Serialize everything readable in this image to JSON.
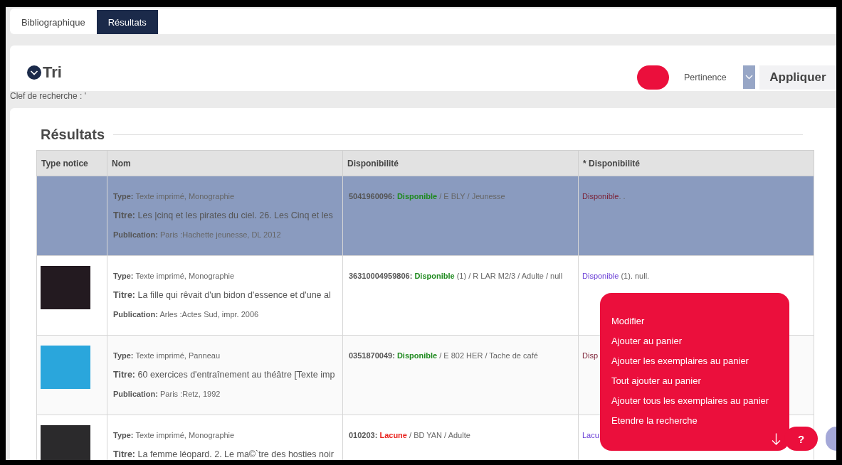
{
  "tabs": [
    {
      "label": "Bibliographique",
      "selected": false
    },
    {
      "label": "Résultats",
      "selected": true
    }
  ],
  "sort": {
    "title": "Tri",
    "select": {
      "value": "Pertinence"
    },
    "apply_button": "Appliquer"
  },
  "search_key": "Clef de recherche : '",
  "results": {
    "title": "Résultats",
    "columns": [
      "Type notice",
      "Nom",
      "Disponibilité",
      "* Disponibilité"
    ],
    "rows": [
      {
        "selected": true,
        "lines": [
          {
            "kind": "type",
            "text": "**Type:** Texte imprimé, Monographie"
          },
          {
            "kind": "title",
            "text": "**Titre:** Les |cinq et les pirates du ciel. 26. Les Cinq et les"
          },
          {
            "kind": "publication",
            "text": "**Publication:** Paris :Hachette jeunesse, DL 2012"
          }
        ],
        "copies": {
          "barcode": "5041960096:",
          "status": "Disponible",
          "color": "#1f8a1f",
          "detail": "/ E BLY / Jeunesse"
        },
        "summary": {
          "status": "Disponible",
          "color": "#7a1e33",
          "detail": ". ."
        }
      },
      {
        "selected": false,
        "cover": {
          "color": "#231a20"
        },
        "lines": [
          {
            "kind": "type",
            "text": "**Type:** Texte imprimé, Monographie"
          },
          {
            "kind": "title",
            "text": "**Titre:** La fille qui rêvait d'un bidon d'essence et d'une al"
          },
          {
            "kind": "publication",
            "text": "**Publication:** Arles :Actes Sud, impr. 2006"
          }
        ],
        "copies": {
          "barcode": "36310004959806:",
          "status": "Disponible",
          "color": "#1f8a1f",
          "detail": "(1) / R LAR M2/3 / Adulte / null"
        },
        "summary": {
          "status": "Disponible",
          "color": "#6a3fd6",
          "detail": " (1). null."
        }
      },
      {
        "selected": false,
        "cover": {
          "color": "#2aa6dc"
        },
        "lines": [
          {
            "kind": "type",
            "text": "**Type:** Texte imprimé, Panneau"
          },
          {
            "kind": "title",
            "text": "**Titre:** 60 exercices d'entraînement au théâtre [Texte imp"
          },
          {
            "kind": "publication",
            "text": "**Publication:** Paris :Retz, 1992"
          }
        ],
        "copies": {
          "barcode": "0351870049:",
          "status": "Disponible",
          "color": "#1f8a1f",
          "detail": "/ E 802 HER / Tache de café"
        },
        "summary": {
          "status": "Disp",
          "color": "#7a1e33"
        }
      },
      {
        "selected": false,
        "cover": {
          "color": "#2b2a2c"
        },
        "lines": [
          {
            "kind": "type",
            "text": "**Type:** Texte imprimé, Monographie"
          },
          {
            "kind": "title",
            "text": "**Titre:** La femme léopard. 2. Le ma©`tre des hosties noir"
          }
        ],
        "copies": {
          "barcode": "010203:",
          "status": "Lacune",
          "color": "#e8231e",
          "detail": "/ BD YAN / Adulte"
        },
        "summary": {
          "status": "Lacu",
          "color": "#6a3fd6"
        }
      }
    ]
  },
  "menu": {
    "items": [
      "Modifier",
      "Ajouter au panier",
      "Ajouter les exemplaires au panier",
      "Tout ajouter au panier",
      "Ajouter tous les exemplaires au panier",
      "Etendre la recherche"
    ]
  },
  "help_button": "?"
}
